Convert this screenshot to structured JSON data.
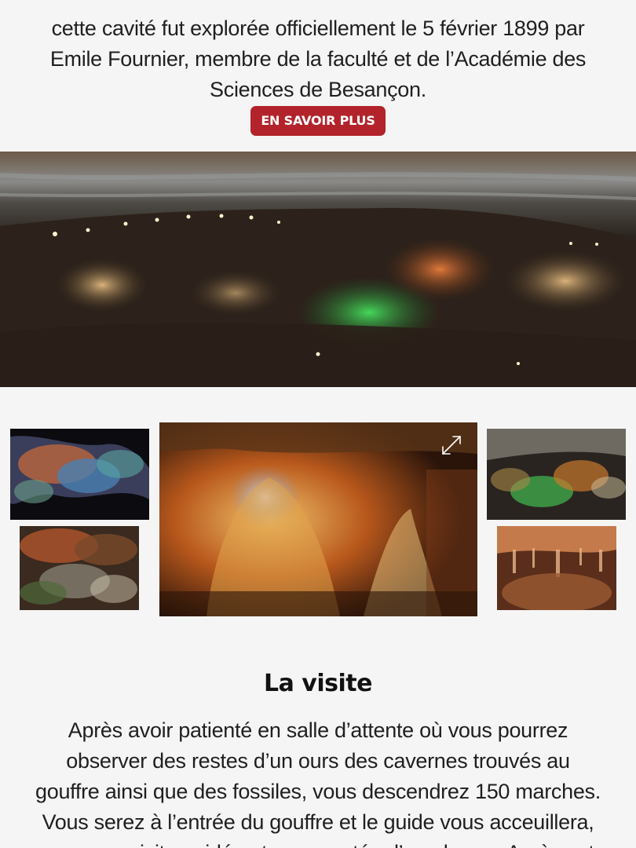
{
  "intro": {
    "text": "cette cavité fut explorée officiellement le 5 février 1899 par Emile Fournier, membre de la faculté et de l’Académie des Sciences de Besançon."
  },
  "cta": {
    "label": "EN SAVOIR PLUS",
    "color": "#b3232b"
  },
  "gallery": {
    "expand_icon": "expand-icon"
  },
  "section": {
    "title": "La visite",
    "body": "Après avoir patienté en salle d’attente où vous pourrez observer des restes d’un ours des cavernes trouvés au gouffre ainsi que des fossiles, vous descendrez 150 marches. Vous serez à l’entrée du gouffre et le guide vous acceuillera, pour une visite guidée et commentée d’une heure. Après cet"
  }
}
